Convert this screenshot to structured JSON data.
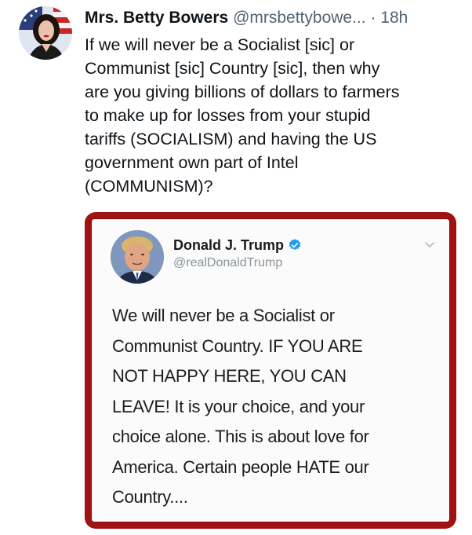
{
  "post": {
    "author": {
      "display_name": "Mrs. Betty Bowers",
      "handle": "@mrsbettybowe...",
      "avatar_icon": "profile-photo-woman-flag"
    },
    "separator": "·",
    "timestamp": "18h",
    "text_lines": [
      "If we will never be a Socialist [sic] or",
      "Communist [sic] Country [sic], then why",
      "are you giving billions of dollars to farmers",
      "to make up for losses from your stupid",
      "tariffs (SOCIALISM) and having the US",
      "government own part of Intel",
      "(COMMUNISM)?"
    ]
  },
  "quoted_image": {
    "frame_color": "#a31212",
    "author": {
      "display_name": "Donald J. Trump",
      "handle": "@realDonaldTrump",
      "verified_icon": "verified-badge-icon",
      "verified_color": "#1d9bf0"
    },
    "text_lines": [
      "We will never be a Socialist or",
      "Communist Country. IF YOU ARE",
      "NOT HAPPY HERE, YOU CAN",
      "LEAVE! It is your choice, and your",
      "choice alone. This is about love for",
      "America. Certain people HATE our",
      "Country...."
    ]
  }
}
